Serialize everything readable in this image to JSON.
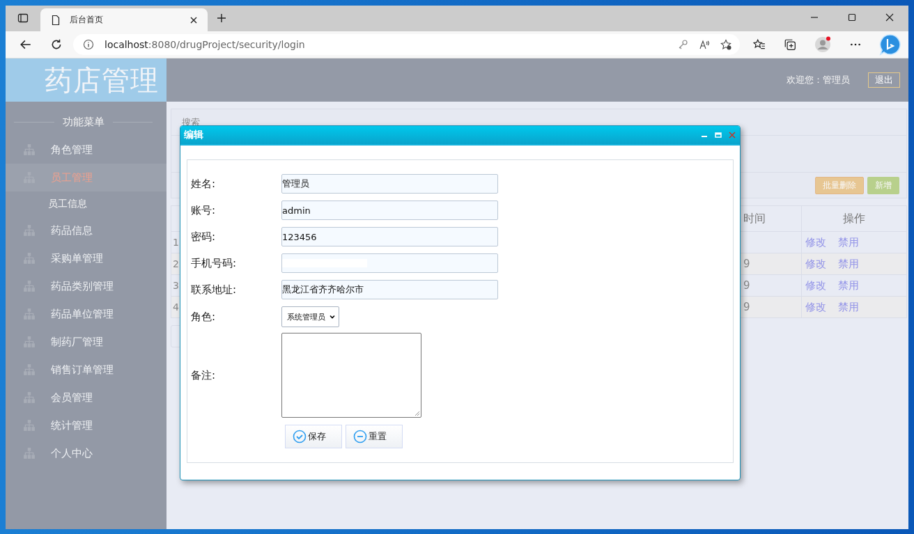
{
  "browser": {
    "tab_title": "后台首页",
    "url_host": "localhost",
    "url_path": ":8080/drugProject/security/login"
  },
  "header": {
    "logo": "药店管理",
    "welcome": "欢迎您：管理员",
    "logout": "退出"
  },
  "sidebar": {
    "title": "功能菜单",
    "items": [
      {
        "label": "角色管理",
        "selected": false
      },
      {
        "label": "员工管理",
        "selected": true,
        "children": [
          {
            "label": "员工信息"
          }
        ]
      },
      {
        "label": "药品信息",
        "selected": false
      },
      {
        "label": "采购单管理",
        "selected": false
      },
      {
        "label": "药品类别管理",
        "selected": false
      },
      {
        "label": "药品单位管理",
        "selected": false
      },
      {
        "label": "制药厂管理",
        "selected": false
      },
      {
        "label": "销售订单管理",
        "selected": false
      },
      {
        "label": "会员管理",
        "selected": false
      },
      {
        "label": "统计管理",
        "selected": false
      },
      {
        "label": "个人中心",
        "selected": false
      }
    ]
  },
  "search_panel": {
    "title": "搜索",
    "buttons": [
      {
        "label": "批量删除",
        "kind": "delete"
      },
      {
        "label": "新增",
        "kind": "add"
      }
    ]
  },
  "table": {
    "columns": [
      "时间",
      "操作"
    ],
    "rows": [
      {
        "column_1": "1",
        "column_2": "",
        "actions": [
          "修改",
          "禁用"
        ]
      },
      {
        "column_1": "2",
        "column_2": "9",
        "actions": [
          "修改",
          "禁用"
        ]
      },
      {
        "column_1": "3",
        "column_2": "9",
        "actions": [
          "修改",
          "禁用"
        ]
      },
      {
        "column_1": "4",
        "column_2": "9",
        "actions": [
          "修改",
          "禁用"
        ]
      }
    ]
  },
  "dialog": {
    "title": "编辑",
    "fields": [
      {
        "label": "姓名:",
        "kind": "text",
        "value": "管理员"
      },
      {
        "label": "账号:",
        "kind": "text",
        "value": "admin"
      },
      {
        "label": "密码:",
        "kind": "text",
        "value": "123456"
      },
      {
        "label": "手机号码:",
        "kind": "text",
        "redacted": true
      },
      {
        "label": "联系地址:",
        "kind": "text",
        "value": "黑龙江省齐齐哈尔市"
      },
      {
        "label": "角色:",
        "kind": "select",
        "value": "系统管理员"
      },
      {
        "label": "备注:",
        "kind": "textarea"
      }
    ],
    "buttons": [
      {
        "label": "保存",
        "kind": "save"
      },
      {
        "label": "重置",
        "kind": "reset"
      }
    ]
  }
}
